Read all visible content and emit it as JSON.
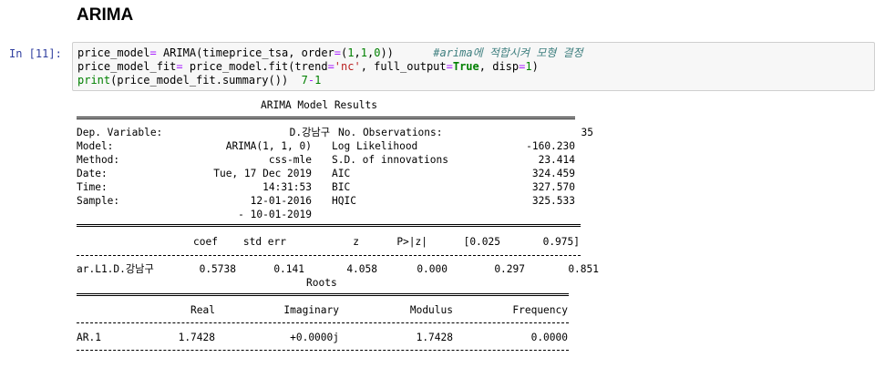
{
  "heading": "ARIMA",
  "cell": {
    "prompt": "In [11]:",
    "code": {
      "l1_a": "price_model",
      "l1_b": "=",
      "l1_c": " ARIMA(timeprice_tsa, order",
      "l1_d": "=",
      "l1_e": "(",
      "l1_f": "1",
      "l1_g": ",",
      "l1_h": "1",
      "l1_i": ",",
      "l1_j": "0",
      "l1_k": "))",
      "l1_comment": "#arima에 적합시켜 모형 결정",
      "l2_a": "price_model_fit",
      "l2_b": "=",
      "l2_c": " price_model.fit(trend",
      "l2_d": "=",
      "l2_e": "'nc'",
      "l2_f": ", full_output",
      "l2_g": "=",
      "l2_h": "True",
      "l2_i": ", disp",
      "l2_j": "=",
      "l2_k": "1",
      "l2_l": ")",
      "l3_a": "print",
      "l3_b": "(price_model_fit.summary())",
      "l3_c": "7",
      "l3_d": "-",
      "l3_e": "1"
    }
  },
  "summary": {
    "title": "ARIMA Model Results",
    "left": [
      {
        "label": "Dep. Variable:",
        "value": "D.강남구"
      },
      {
        "label": "Model:",
        "value": "ARIMA(1, 1, 0)"
      },
      {
        "label": "Method:",
        "value": "css-mle"
      },
      {
        "label": "Date:",
        "value": "Tue, 17 Dec 2019"
      },
      {
        "label": "Time:",
        "value": "14:31:53"
      },
      {
        "label": "Sample:",
        "value": "12-01-2016"
      },
      {
        "label": "",
        "value": "- 10-01-2019"
      }
    ],
    "right": [
      {
        "label": "No. Observations:",
        "value": "35"
      },
      {
        "label": "Log Likelihood",
        "value": "-160.230"
      },
      {
        "label": "S.D. of innovations",
        "value": "23.414"
      },
      {
        "label": "AIC",
        "value": "324.459"
      },
      {
        "label": "BIC",
        "value": "327.570"
      },
      {
        "label": "HQIC",
        "value": "325.533"
      }
    ]
  },
  "coef_table": {
    "headers": [
      "coef",
      "std err",
      "z",
      "P>|z|",
      "[0.025",
      "0.975]"
    ],
    "rows": [
      {
        "name": "ar.L1.D.강남구",
        "values": [
          "0.5738",
          "0.141",
          "4.058",
          "0.000",
          "0.297",
          "0.851"
        ]
      }
    ]
  },
  "roots": {
    "title": "Roots",
    "headers": [
      "Real",
      "Imaginary",
      "Modulus",
      "Frequency"
    ],
    "rows": [
      {
        "name": "AR.1",
        "values": [
          "1.7428",
          "+0.0000j",
          "1.7428",
          "0.0000"
        ]
      }
    ]
  }
}
